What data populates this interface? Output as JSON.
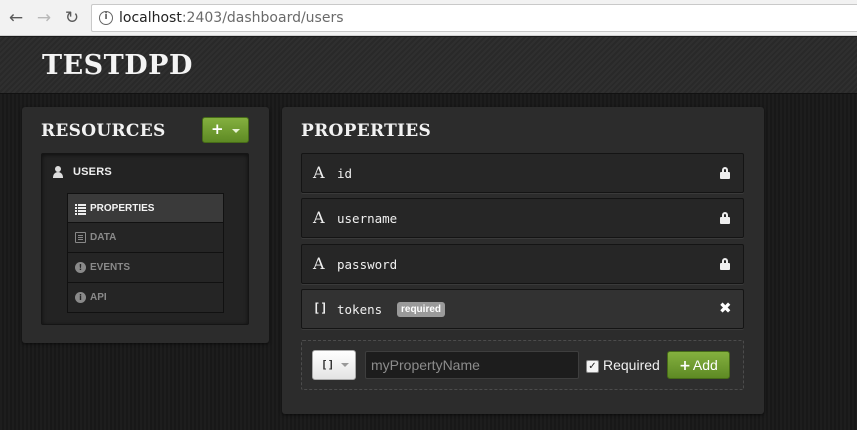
{
  "browser": {
    "url_host": "localhost",
    "url_path": ":2403/dashboard/users"
  },
  "app": {
    "brand": "TESTDPD"
  },
  "resources": {
    "title": "RESOURCES",
    "add_label": "+",
    "root": {
      "label": "USERS",
      "icon": "user-icon"
    },
    "items": [
      {
        "label": "PROPERTIES",
        "icon": "list-icon",
        "active": true
      },
      {
        "label": "DATA",
        "icon": "document-icon",
        "active": false
      },
      {
        "label": "EVENTS",
        "icon": "exclamation-icon",
        "active": false
      },
      {
        "label": "API",
        "icon": "info-icon",
        "active": false
      }
    ]
  },
  "properties": {
    "title": "PROPERTIES",
    "rows": [
      {
        "type_glyph": "A",
        "name": "id",
        "locked": true
      },
      {
        "type_glyph": "A",
        "name": "username",
        "locked": true
      },
      {
        "type_glyph": "A",
        "name": "password",
        "locked": true
      },
      {
        "type_glyph": "[]",
        "name": "tokens",
        "badge": "required",
        "locked": false
      }
    ],
    "new_property": {
      "type_value": "[]",
      "name_placeholder": "myPropertyName",
      "required_checked": true,
      "required_label": "Required",
      "add_label": "Add"
    }
  },
  "colors": {
    "accent_green": "#6b9a2e",
    "background": "#1b1b1b",
    "panel": "#2c2c2c"
  }
}
